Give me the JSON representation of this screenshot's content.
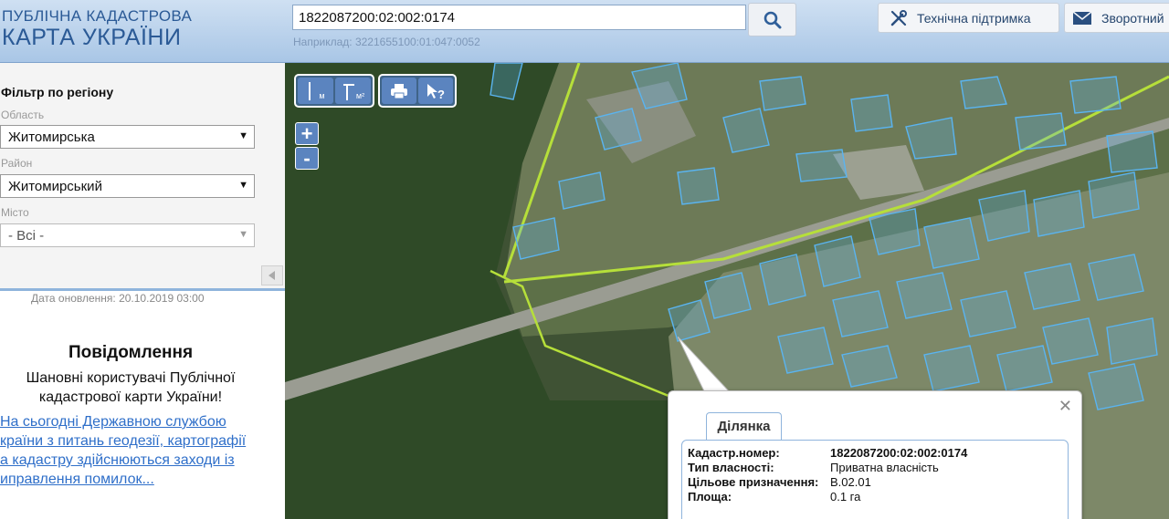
{
  "header": {
    "logo_line1": "ПУБЛІЧНА КАДАСТРОВА",
    "logo_line2": "КАРТА УКРАЇНИ",
    "search_value": "1822087200:02:002:0174",
    "search_example": "Наприклад: 3221655100:01:047:0052",
    "search_icon": "search-icon",
    "support_label": "Технічна підтримка",
    "feedback_label": "Зворотний"
  },
  "sidebar": {
    "filter_title": "Фільтр по регіону",
    "region_label": "Область",
    "region_value": "Житомирська",
    "district_label": "Район",
    "district_value": "Житомирський",
    "city_label": "Місто",
    "city_value": "- Всі -",
    "update_date": "Дата оновлення: 20.10.2019 03:00",
    "notice_title": "Повідомлення",
    "notice_text": "Шановні користувачі Публічної кадастрової карти України!",
    "notice_link": "   На сьогодні Державною службою\nкраїни з питань геодезії, картографії\nа кадастру здійснюються заходи із\nиправлення помилок..."
  },
  "map": {
    "tools": {
      "measure_label": "м",
      "area_label": "м²",
      "info_label": "?"
    },
    "zoom_in": "+",
    "zoom_out": "-",
    "popup": {
      "tab": "Ділянка",
      "rows": [
        {
          "key": "Кадастр.номер:",
          "value": "1822087200:02:002:0174"
        },
        {
          "key": "Тип власності:",
          "value": "Приватна власність"
        },
        {
          "key": "Цільове призначення:",
          "value": "B.02.01"
        },
        {
          "key": "Площа:",
          "value": "0.1 га"
        }
      ]
    }
  },
  "colors": {
    "brand": "#2b5a96",
    "parcel_outline": "#5ab4f0",
    "boundary": "#b6df3a",
    "link": "#2f6fc9"
  }
}
